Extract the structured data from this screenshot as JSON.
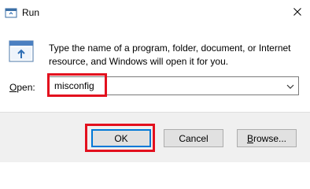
{
  "window": {
    "title": "Run",
    "icon": "run-app-icon",
    "close_icon": "close-icon"
  },
  "message": {
    "line1": "Type the name of a program, folder, document, or Internet",
    "line2": "resource, and Windows will open it for you."
  },
  "open_field": {
    "label_underlined": "O",
    "label_rest": "pen:",
    "value": "misconfig",
    "dropdown_icon": "chevron-down-icon"
  },
  "buttons": {
    "ok": "OK",
    "cancel": "Cancel",
    "browse_underlined": "B",
    "browse_rest": "rowse..."
  },
  "colors": {
    "highlight": "#e3101e",
    "footer_bg": "#f0f0f0",
    "button_bg": "#e1e1e1",
    "focus_border": "#0078d7"
  }
}
